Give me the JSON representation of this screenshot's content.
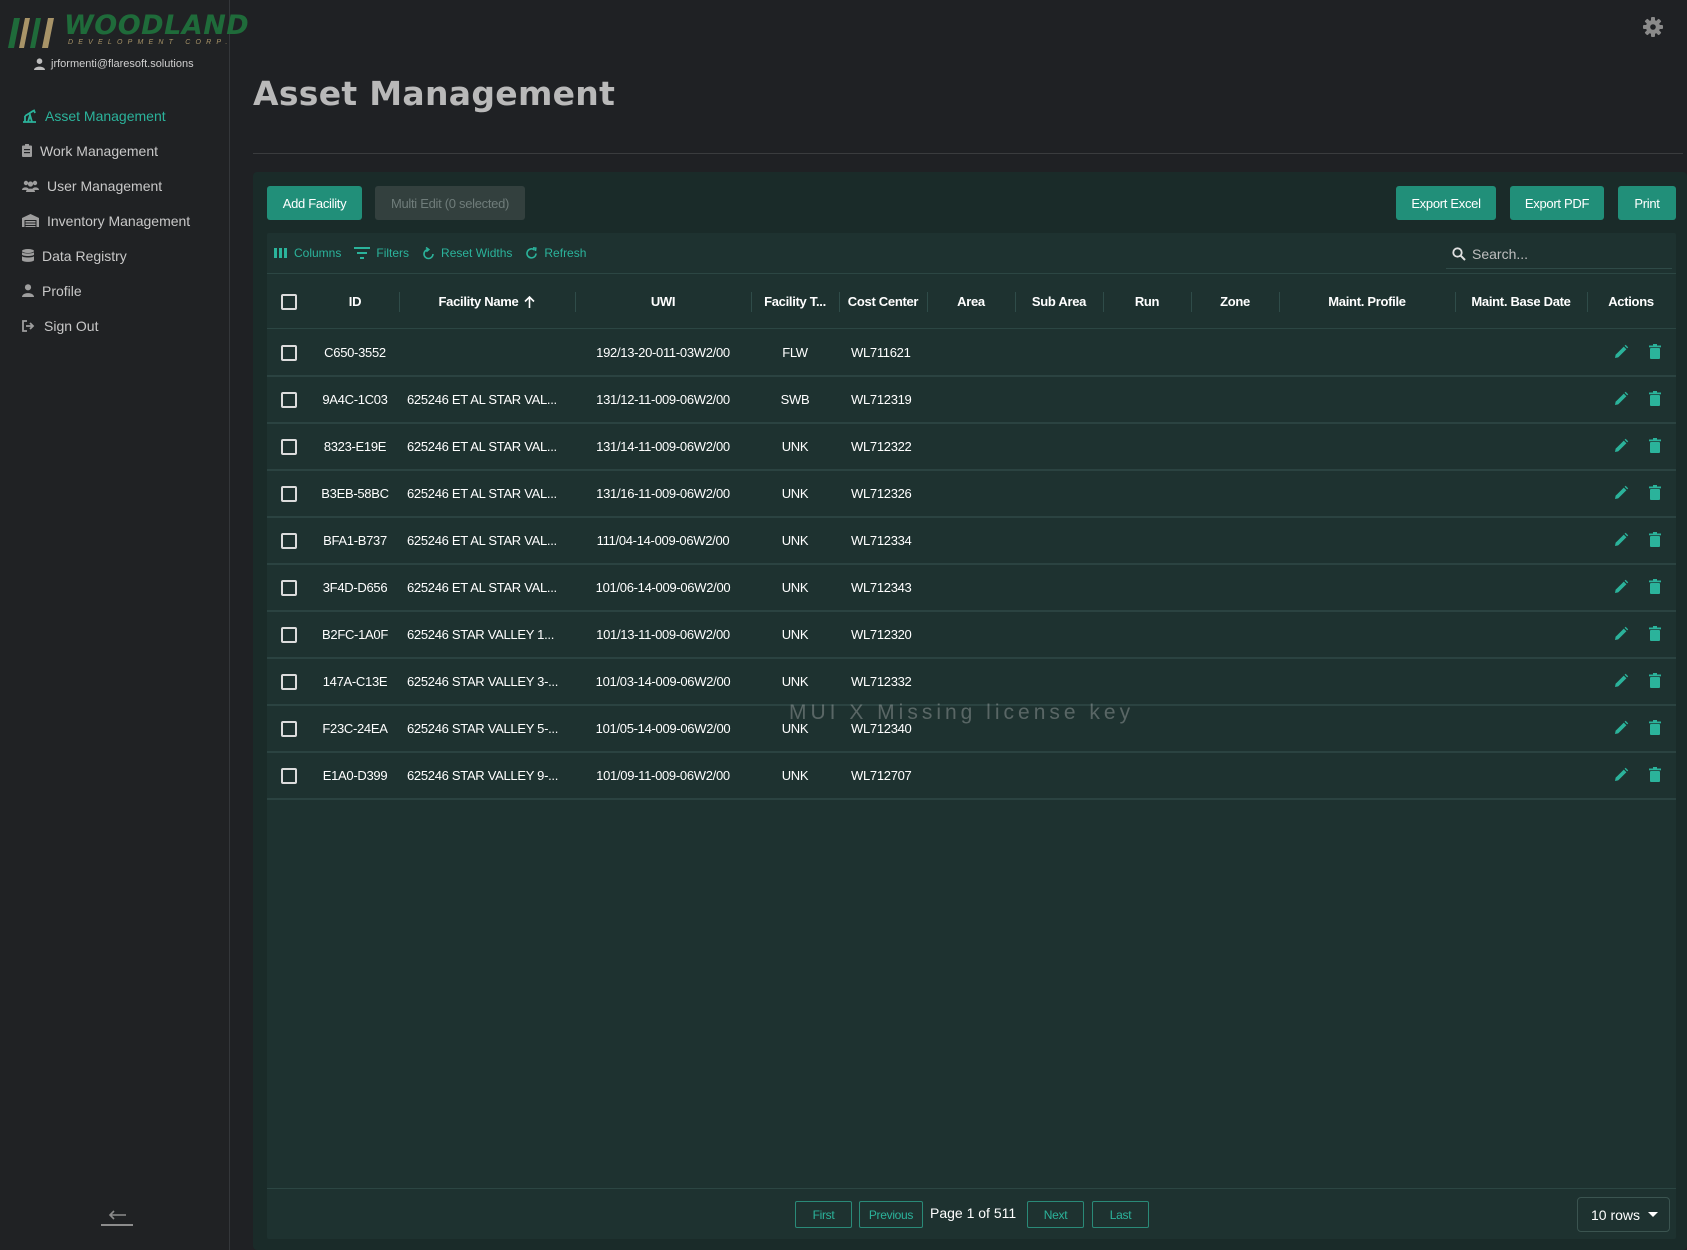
{
  "brand": {
    "name": "WOODLAND",
    "subtitle": "DEVELOPMENT CORP.",
    "colors": {
      "word": "#1f6b3a",
      "accent": "#2bb39b"
    }
  },
  "user": {
    "email": "jrformenti@flaresoft.solutions"
  },
  "nav": {
    "items": [
      {
        "label": "Asset Management",
        "icon": "oil-pump-icon",
        "active": true
      },
      {
        "label": "Work Management",
        "icon": "clipboard-icon",
        "active": false
      },
      {
        "label": "User Management",
        "icon": "users-icon",
        "active": false
      },
      {
        "label": "Inventory Management",
        "icon": "warehouse-icon",
        "active": false
      },
      {
        "label": "Data Registry",
        "icon": "database-icon",
        "active": false
      },
      {
        "label": "Profile",
        "icon": "user-icon",
        "active": false
      },
      {
        "label": "Sign Out",
        "icon": "sign-out-icon",
        "active": false
      }
    ]
  },
  "page": {
    "title": "Asset Management"
  },
  "actions": {
    "add_facility": "Add Facility",
    "multi_edit": "Multi Edit (0 selected)",
    "export_excel": "Export Excel",
    "export_pdf": "Export PDF",
    "print": "Print"
  },
  "toolbar": {
    "columns": "Columns",
    "filters": "Filters",
    "reset_widths": "Reset Widths",
    "refresh": "Refresh",
    "search_placeholder": "Search..."
  },
  "table": {
    "columns": [
      "ID",
      "Facility Name",
      "UWI",
      "Facility T...",
      "Cost Center",
      "Area",
      "Sub Area",
      "Run",
      "Zone",
      "Maint. Profile",
      "Maint. Base Date",
      "Actions"
    ],
    "sorted_column": "Facility Name",
    "sort_direction": "ascending",
    "rows": [
      {
        "id": "C650-3552",
        "name": "",
        "uwi": "192/13-20-011-03W2/00",
        "type": "FLW",
        "cost_center": "WL711621"
      },
      {
        "id": "9A4C-1C03",
        "name": "625246 ET AL STAR VAL...",
        "uwi": "131/12-11-009-06W2/00",
        "type": "SWB",
        "cost_center": "WL712319"
      },
      {
        "id": "8323-E19E",
        "name": "625246 ET AL STAR VAL...",
        "uwi": "131/14-11-009-06W2/00",
        "type": "UNK",
        "cost_center": "WL712322"
      },
      {
        "id": "B3EB-58BC",
        "name": "625246 ET AL STAR VAL...",
        "uwi": "131/16-11-009-06W2/00",
        "type": "UNK",
        "cost_center": "WL712326"
      },
      {
        "id": "BFA1-B737",
        "name": "625246 ET AL STAR VAL...",
        "uwi": "111/04-14-009-06W2/00",
        "type": "UNK",
        "cost_center": "WL712334"
      },
      {
        "id": "3F4D-D656",
        "name": "625246 ET AL STAR VAL...",
        "uwi": "101/06-14-009-06W2/00",
        "type": "UNK",
        "cost_center": "WL712343"
      },
      {
        "id": "B2FC-1A0F",
        "name": "625246 STAR VALLEY 1...",
        "uwi": "101/13-11-009-06W2/00",
        "type": "UNK",
        "cost_center": "WL712320"
      },
      {
        "id": "147A-C13E",
        "name": "625246 STAR VALLEY 3-...",
        "uwi": "101/03-14-009-06W2/00",
        "type": "UNK",
        "cost_center": "WL712332"
      },
      {
        "id": "F23C-24EA",
        "name": "625246 STAR VALLEY 5-...",
        "uwi": "101/05-14-009-06W2/00",
        "type": "UNK",
        "cost_center": "WL712340"
      },
      {
        "id": "E1A0-D399",
        "name": "625246 STAR VALLEY 9-...",
        "uwi": "101/09-11-009-06W2/00",
        "type": "UNK",
        "cost_center": "WL712707"
      }
    ]
  },
  "watermark": "MUI X Missing license key",
  "pagination": {
    "first": "First",
    "previous": "Previous",
    "info": "Page 1 of 511",
    "next": "Next",
    "last": "Last",
    "rows_per_page": "10 rows"
  }
}
